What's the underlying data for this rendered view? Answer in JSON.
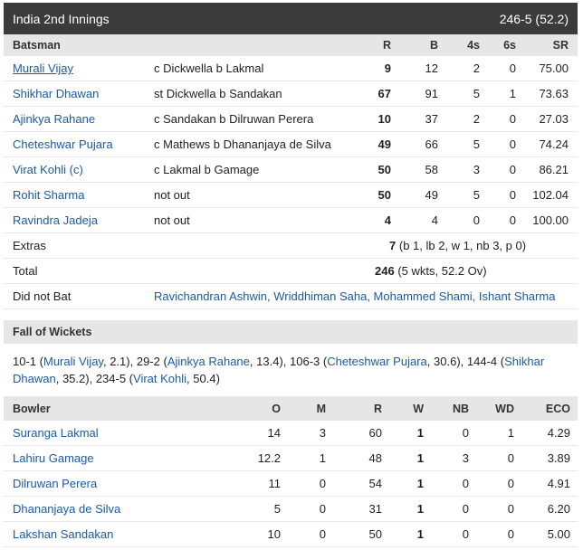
{
  "innings": {
    "title": "India 2nd Innings",
    "score": "246-5 (52.2)"
  },
  "batting": {
    "headers": {
      "batsman": "Batsman",
      "r": "R",
      "b": "B",
      "fours": "4s",
      "sixes": "6s",
      "sr": "SR"
    },
    "rows": [
      {
        "name": "Murali Vijay",
        "dismissal": "c Dickwella b Lakmal",
        "r": "9",
        "b": "12",
        "fours": "2",
        "sixes": "0",
        "sr": "75.00"
      },
      {
        "name": "Shikhar Dhawan",
        "dismissal": "st Dickwella b Sandakan",
        "r": "67",
        "b": "91",
        "fours": "5",
        "sixes": "1",
        "sr": "73.63"
      },
      {
        "name": "Ajinkya Rahane",
        "dismissal": "c Sandakan b Dilruwan Perera",
        "r": "10",
        "b": "37",
        "fours": "2",
        "sixes": "0",
        "sr": "27.03"
      },
      {
        "name": "Cheteshwar Pujara",
        "dismissal": "c Mathews b Dhananjaya de Silva",
        "r": "49",
        "b": "66",
        "fours": "5",
        "sixes": "0",
        "sr": "74.24"
      },
      {
        "name": "Virat Kohli (c)",
        "dismissal": "c Lakmal b Gamage",
        "r": "50",
        "b": "58",
        "fours": "3",
        "sixes": "0",
        "sr": "86.21"
      },
      {
        "name": "Rohit Sharma",
        "dismissal": "not out",
        "r": "50",
        "b": "49",
        "fours": "5",
        "sixes": "0",
        "sr": "102.04"
      },
      {
        "name": "Ravindra Jadeja",
        "dismissal": "not out",
        "r": "4",
        "b": "4",
        "fours": "0",
        "sixes": "0",
        "sr": "100.00"
      }
    ],
    "extras": {
      "label": "Extras",
      "value": "7",
      "detail": "(b 1, lb 2, w 1, nb 3, p 0)"
    },
    "total": {
      "label": "Total",
      "value": "246",
      "detail": "(5 wkts, 52.2 Ov)"
    },
    "did_not_bat": {
      "label": "Did not Bat",
      "players": "Ravichandran Ashwin, Wriddhiman Saha, Mohammed Shami, Ishant Sharma"
    }
  },
  "fall_of_wickets": {
    "title": "Fall of Wickets",
    "items": [
      {
        "score": "10-1",
        "player": "Murali Vijay",
        "over": "2.1"
      },
      {
        "score": "29-2",
        "player": "Ajinkya Rahane",
        "over": "13.4"
      },
      {
        "score": "106-3",
        "player": "Cheteshwar Pujara",
        "over": "30.6"
      },
      {
        "score": "144-4",
        "player": "Shikhar Dhawan",
        "over": "35.2"
      },
      {
        "score": "234-5",
        "player": "Virat Kohli",
        "over": "50.4"
      }
    ]
  },
  "bowling": {
    "headers": {
      "bowler": "Bowler",
      "o": "O",
      "m": "M",
      "r": "R",
      "w": "W",
      "nb": "NB",
      "wd": "WD",
      "eco": "ECO"
    },
    "rows": [
      {
        "name": "Suranga Lakmal",
        "o": "14",
        "m": "3",
        "r": "60",
        "w": "1",
        "nb": "0",
        "wd": "1",
        "eco": "4.29"
      },
      {
        "name": "Lahiru Gamage",
        "o": "12.2",
        "m": "1",
        "r": "48",
        "w": "1",
        "nb": "3",
        "wd": "0",
        "eco": "3.89"
      },
      {
        "name": "Dilruwan Perera",
        "o": "11",
        "m": "0",
        "r": "54",
        "w": "1",
        "nb": "0",
        "wd": "0",
        "eco": "4.91"
      },
      {
        "name": "Dhananjaya de Silva",
        "o": "5",
        "m": "0",
        "r": "31",
        "w": "1",
        "nb": "0",
        "wd": "0",
        "eco": "6.20"
      },
      {
        "name": "Lakshan Sandakan",
        "o": "10",
        "m": "0",
        "r": "50",
        "w": "1",
        "nb": "0",
        "wd": "0",
        "eco": "5.00"
      }
    ]
  }
}
